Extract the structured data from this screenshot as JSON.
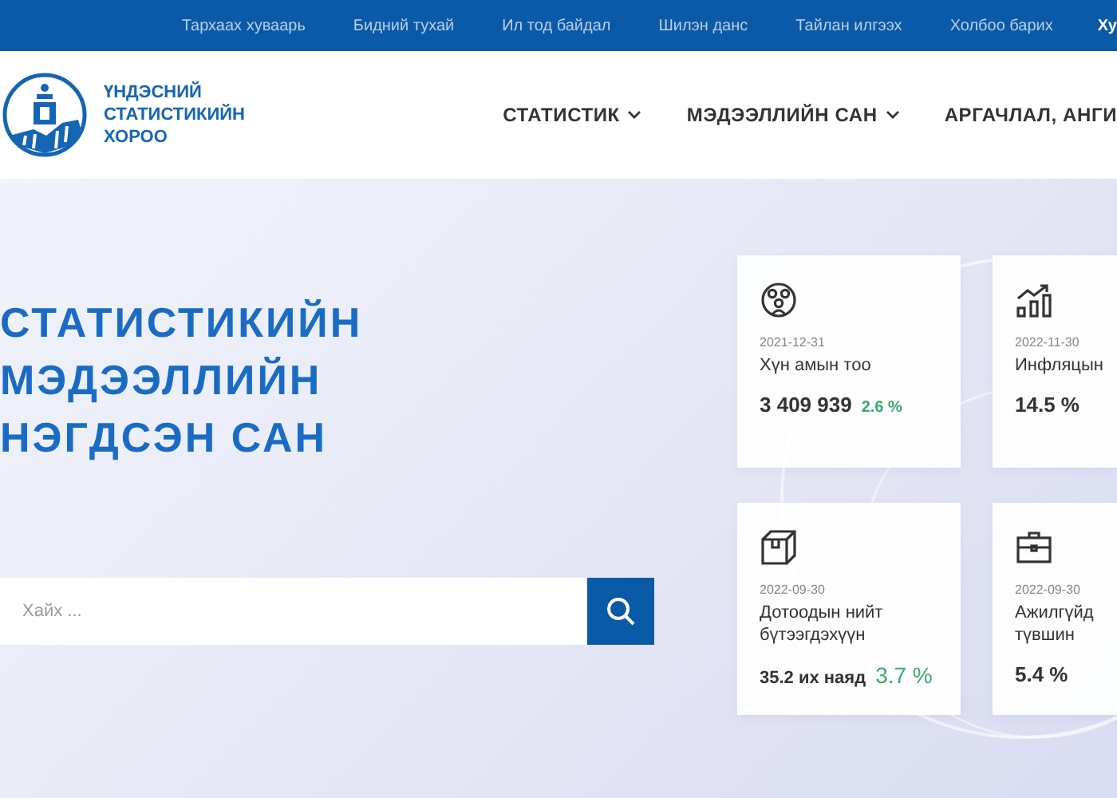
{
  "top_bar": {
    "links": [
      "Тархаах хуваарь",
      "Бидний тухай",
      "Ил тод байдал",
      "Шилэн данс",
      "Тайлан илгээх",
      "Холбоо барих",
      "Ху"
    ]
  },
  "header": {
    "logo_text": [
      "ҮНДЭСНИЙ",
      "СТАТИСТИКИЙН",
      "ХОРОО"
    ],
    "nav": [
      {
        "label": "СТАТИСТИК",
        "dropdown": true
      },
      {
        "label": "МЭДЭЭЛЛИЙН САН",
        "dropdown": true
      },
      {
        "label": "АРГАЧЛАЛ, АНГИ",
        "dropdown": false
      }
    ]
  },
  "hero": {
    "title": [
      "СТАТИСТИКИЙН",
      "МЭДЭЭЛЛИЙН",
      "НЭГДСЭН САН"
    ],
    "search": {
      "placeholder": "Хайх ..."
    }
  },
  "cards": [
    {
      "kind": "people",
      "date": "2021-12-31",
      "title": "Хүн амын тоо",
      "value": "3 409 939",
      "change": "2.6 %"
    },
    {
      "kind": "growth",
      "date": "2022-11-30",
      "title": "Инфляцын",
      "value": "14.5 %"
    },
    {
      "kind": "box",
      "date": "2022-09-30",
      "title": "Дотоодын нийт бүтээгдэхүүн",
      "value": "35.2 их наяд",
      "change": "3.7 %"
    },
    {
      "kind": "briefcase",
      "date": "2022-09-30",
      "title": "Ажилгүйд түвшин",
      "value": "5.4 %"
    }
  ]
}
